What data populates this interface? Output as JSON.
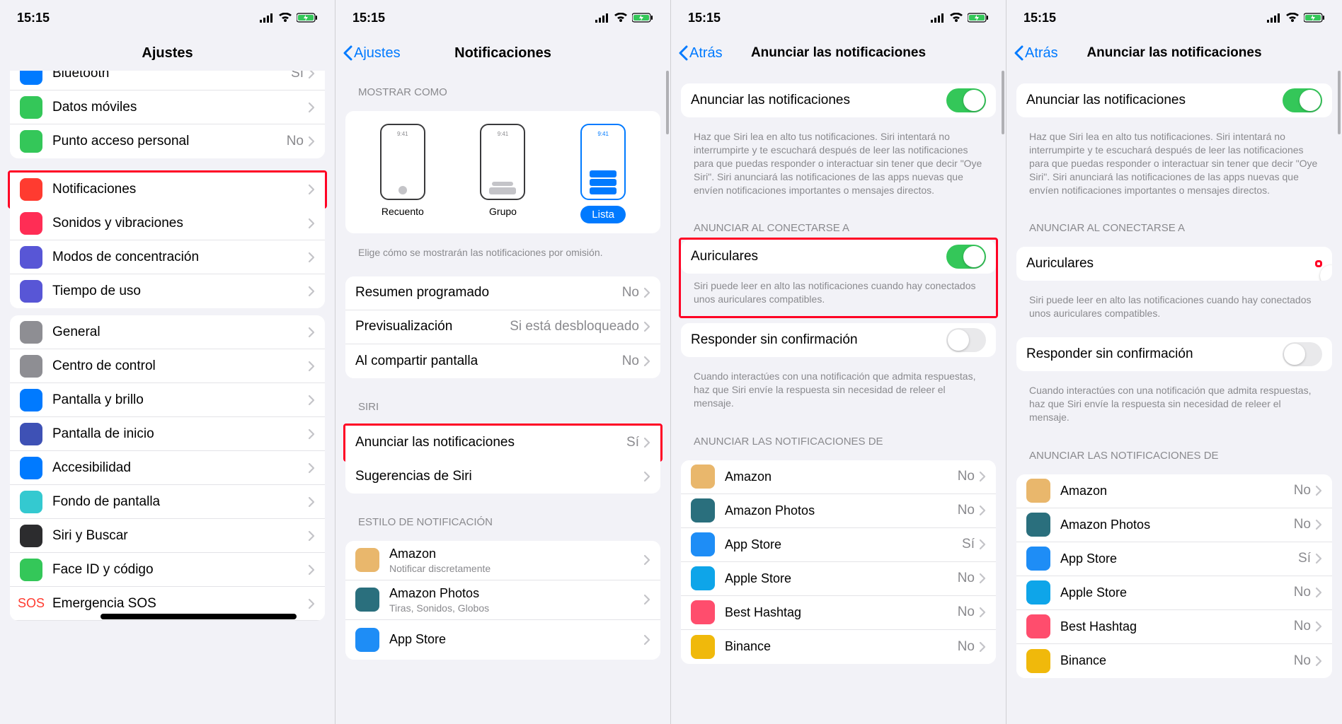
{
  "status": {
    "time": "15:15"
  },
  "screen1": {
    "title": "Ajustes",
    "rows_top": [
      {
        "name": "bluetooth",
        "label": "Bluetooth",
        "value": "Sí",
        "icon_bg": "#007aff"
      },
      {
        "name": "datos-moviles",
        "label": "Datos móviles",
        "value": "",
        "icon_bg": "#34c759"
      },
      {
        "name": "punto-acceso",
        "label": "Punto acceso personal",
        "value": "No",
        "icon_bg": "#34c759"
      }
    ],
    "rows_mid": [
      {
        "name": "notificaciones",
        "label": "Notificaciones",
        "value": "",
        "icon_bg": "#ff3b30",
        "hl": true
      },
      {
        "name": "sonidos",
        "label": "Sonidos y vibraciones",
        "value": "",
        "icon_bg": "#ff2d55"
      },
      {
        "name": "concentracion",
        "label": "Modos de concentración",
        "value": "",
        "icon_bg": "#5856d6"
      },
      {
        "name": "tiempo-uso",
        "label": "Tiempo de uso",
        "value": "",
        "icon_bg": "#5856d6"
      }
    ],
    "rows_bot": [
      {
        "name": "general",
        "label": "General",
        "icon_bg": "#8e8e93"
      },
      {
        "name": "centro-control",
        "label": "Centro de control",
        "icon_bg": "#8e8e93"
      },
      {
        "name": "pantalla-brillo",
        "label": "Pantalla y brillo",
        "icon_bg": "#007aff"
      },
      {
        "name": "pantalla-inicio",
        "label": "Pantalla de inicio",
        "icon_bg": "#3e51b5"
      },
      {
        "name": "accesibilidad",
        "label": "Accesibilidad",
        "icon_bg": "#007aff"
      },
      {
        "name": "fondo-pantalla",
        "label": "Fondo de pantalla",
        "icon_bg": "#34c9d0"
      },
      {
        "name": "siri-buscar",
        "label": "Siri y Buscar",
        "icon_bg": "#2c2c2e"
      },
      {
        "name": "faceid",
        "label": "Face ID y código",
        "icon_bg": "#34c759"
      },
      {
        "name": "sos",
        "label": "Emergencia SOS",
        "icon_bg": "#ffffff",
        "icon_text": "SOS",
        "icon_color": "#ff3b30"
      }
    ]
  },
  "screen2": {
    "back": "Ajustes",
    "title": "Notificaciones",
    "show_as_header": "MOSTRAR COMO",
    "preview_mock_time": "9:41",
    "preview": [
      {
        "label": "Recuento"
      },
      {
        "label": "Grupo"
      },
      {
        "label": "Lista",
        "selected": true
      }
    ],
    "show_as_foot": "Elige cómo se mostrarán las notificaciones por omisión.",
    "rows_a": [
      {
        "name": "resumen",
        "label": "Resumen programado",
        "value": "No"
      },
      {
        "name": "previs",
        "label": "Previsualización",
        "value": "Si está desbloqueado"
      },
      {
        "name": "compartir",
        "label": "Al compartir pantalla",
        "value": "No"
      }
    ],
    "siri_header": "SIRI",
    "rows_siri": [
      {
        "name": "anunciar",
        "label": "Anunciar las notificaciones",
        "value": "Sí",
        "hl": true
      },
      {
        "name": "sugerencias",
        "label": "Sugerencias de Siri",
        "value": ""
      }
    ],
    "style_header": "ESTILO DE NOTIFICACIÓN",
    "apps": [
      {
        "name": "amazon",
        "label": "Amazon",
        "sub": "Notificar discretamente",
        "color": "#e9b76c"
      },
      {
        "name": "amazon-photos",
        "label": "Amazon Photos",
        "sub": "Tiras, Sonidos, Globos",
        "color": "#2a6f7d"
      },
      {
        "name": "app-store",
        "label": "App Store",
        "sub": "",
        "color": "#1e8df6"
      }
    ]
  },
  "screen3": {
    "back": "Atrás",
    "title": "Anunciar las notificaciones",
    "main_label": "Anunciar las notificaciones",
    "main_on": true,
    "main_foot": "Haz que Siri lea en alto tus notificaciones. Siri intentará no interrumpirte y te escuchará después de leer las notificaciones para que puedas responder o interactuar sin tener que decir \"Oye Siri\". Siri anunciará las notificaciones de las apps nuevas que envíen notificaciones importantes o mensajes directos.",
    "connect_header": "ANUNCIAR AL CONECTARSE A",
    "headphones_label": "Auriculares",
    "headphones_on": true,
    "headphones_hl": true,
    "headphones_foot": "Siri puede leer en alto las notificaciones cuando hay conectados unos auriculares compatibles.",
    "reply_label": "Responder sin confirmación",
    "reply_on": false,
    "reply_foot": "Cuando interactúes con una notificación que admita respuestas, haz que Siri envíe la respuesta sin necesidad de releer el mensaje.",
    "apps_header": "ANUNCIAR LAS NOTIFICACIONES DE",
    "apps": [
      {
        "name": "amazon",
        "label": "Amazon",
        "value": "No",
        "color": "#e9b76c"
      },
      {
        "name": "amazon-photos",
        "label": "Amazon Photos",
        "value": "No",
        "color": "#2a6f7d"
      },
      {
        "name": "app-store",
        "label": "App Store",
        "value": "Sí",
        "color": "#1e8df6"
      },
      {
        "name": "apple-store",
        "label": "Apple Store",
        "value": "No",
        "color": "#0ea5e9"
      },
      {
        "name": "best-hashtag",
        "label": "Best Hashtag",
        "value": "No",
        "color": "#ff4d6d"
      },
      {
        "name": "binance",
        "label": "Binance",
        "value": "No",
        "color": "#f0b90b"
      }
    ]
  },
  "screen4": {
    "back": "Atrás",
    "title": "Anunciar las notificaciones",
    "main_label": "Anunciar las notificaciones",
    "main_on": true,
    "main_foot": "Haz que Siri lea en alto tus notificaciones. Siri intentará no interrumpirte y te escuchará después de leer las notificaciones para que puedas responder o interactuar sin tener que decir \"Oye Siri\". Siri anunciará las notificaciones de las apps nuevas que envíen notificaciones importantes o mensajes directos.",
    "connect_header": "ANUNCIAR AL CONECTARSE A",
    "headphones_label": "Auriculares",
    "headphones_on": false,
    "headphones_hl": true,
    "headphones_hl_toggle_only": true,
    "headphones_foot": "Siri puede leer en alto las notificaciones cuando hay conectados unos auriculares compatibles.",
    "reply_label": "Responder sin confirmación",
    "reply_on": false,
    "reply_foot": "Cuando interactúes con una notificación que admita respuestas, haz que Siri envíe la respuesta sin necesidad de releer el mensaje.",
    "apps_header": "ANUNCIAR LAS NOTIFICACIONES DE",
    "apps": [
      {
        "name": "amazon",
        "label": "Amazon",
        "value": "No",
        "color": "#e9b76c"
      },
      {
        "name": "amazon-photos",
        "label": "Amazon Photos",
        "value": "No",
        "color": "#2a6f7d"
      },
      {
        "name": "app-store",
        "label": "App Store",
        "value": "Sí",
        "color": "#1e8df6"
      },
      {
        "name": "apple-store",
        "label": "Apple Store",
        "value": "No",
        "color": "#0ea5e9"
      },
      {
        "name": "best-hashtag",
        "label": "Best Hashtag",
        "value": "No",
        "color": "#ff4d6d"
      },
      {
        "name": "binance",
        "label": "Binance",
        "value": "No",
        "color": "#f0b90b"
      }
    ]
  }
}
